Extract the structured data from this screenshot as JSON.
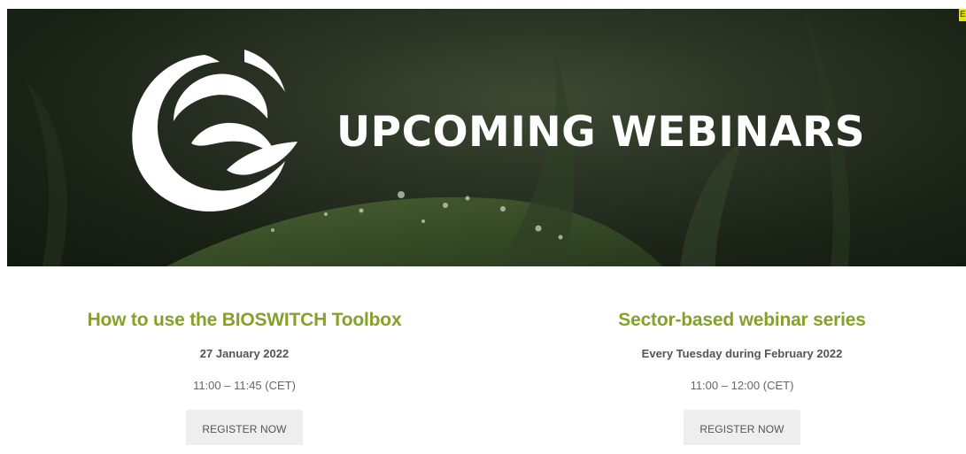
{
  "banner": {
    "title": "UPCOMING WEBINARS",
    "logo_icon": "bioswitch-swirl-logo-icon",
    "corner_tag": "E"
  },
  "colors": {
    "accent_green": "#86a028",
    "button_bg": "#eeeeee",
    "text_gray": "#555555"
  },
  "events": [
    {
      "title": "How to use the BIOSWITCH Toolbox",
      "date": "27 January 2022",
      "time": "11:00 – 11:45 (CET)",
      "button_label": "REGISTER NOW"
    },
    {
      "title": "Sector-based webinar series",
      "date": "Every Tuesday during February 2022",
      "time": "11:00 – 12:00 (CET)",
      "button_label": "REGISTER NOW"
    }
  ]
}
